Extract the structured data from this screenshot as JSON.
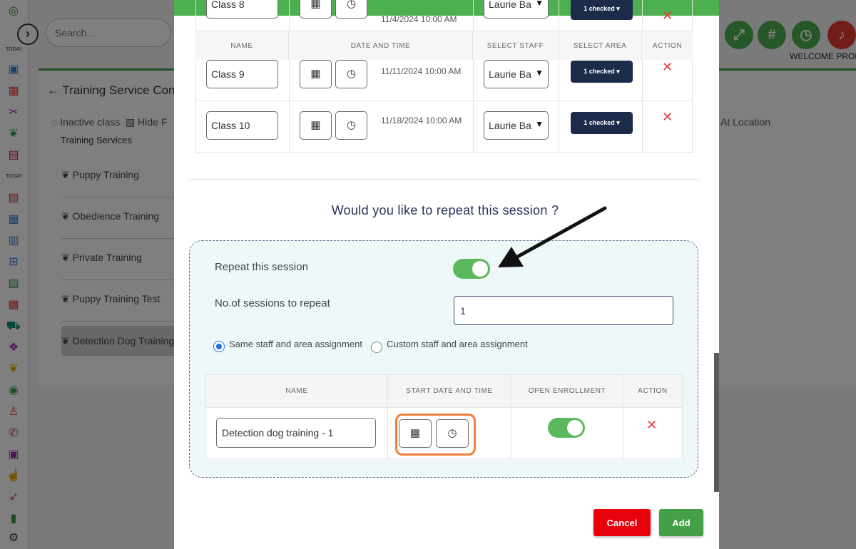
{
  "background": {
    "search_placeholder": "Search...",
    "welcome": "WELCOME PROD",
    "page_title": "Training Service Confi",
    "filter_inactive": "Inactive class",
    "filter_hide": "Hide F",
    "at_location": "At Location",
    "services_heading": "Training Services",
    "services": [
      "Puppy Training",
      "Obedience Training",
      "Private Training",
      "Puppy Training Test",
      "Detection Dog Training"
    ],
    "top_icons": [
      "expand-icon",
      "hash-icon",
      "clock-icon",
      "bell-icon"
    ],
    "rail_icons": [
      "dashboard-icon",
      "calendar-icon",
      "grooming-icon",
      "paw-icon",
      "kennel-icon",
      "today-icon",
      "badge-icon",
      "schedule-icon",
      "event-icon",
      "grid-icon",
      "report-icon",
      "card-icon",
      "cart-icon",
      "dog-icon",
      "paw2-icon",
      "target-icon",
      "user-icon",
      "chat-icon",
      "gallery-icon",
      "thumbsup-icon",
      "rocket-icon",
      "stats-icon",
      "settings-icon"
    ]
  },
  "classes_table": {
    "headers": [
      "NAME",
      "DATE AND TIME",
      "SELECT STAFF",
      "SELECT AREA",
      "ACTION"
    ],
    "rows": [
      {
        "name": "Class 8",
        "datetime": "11/4/2024 10:00 AM",
        "staff": "Laurie Ba",
        "area": "1 checked"
      },
      {
        "name": "Class 9",
        "datetime": "11/11/2024 10:00 AM",
        "staff": "Laurie Ba",
        "area": "1 checked"
      },
      {
        "name": "Class 10",
        "datetime": "11/18/2024 10:00 AM",
        "staff": "Laurie Ba",
        "area": "1 checked"
      }
    ],
    "delete_glyph": "✕"
  },
  "repeat": {
    "question": "Would you like to repeat this session ?",
    "toggle_label": "Repeat this session",
    "toggle_on": true,
    "sessions_label": "No.of sessions to repeat",
    "sessions_value": "1",
    "radio_same": "Same staff and area assignment",
    "radio_custom": "Custom staff and area assignment",
    "selected_radio": "same"
  },
  "sessions_table": {
    "headers": [
      "NAME",
      "START DATE AND TIME",
      "OPEN ENROLLMENT",
      "ACTION"
    ],
    "rows": [
      {
        "name": "Detection dog training - 1",
        "open_enrollment": true
      }
    ]
  },
  "actions": {
    "cancel": "Cancel",
    "add": "Add"
  },
  "colors": {
    "accent_green": "#4caf50",
    "navy": "#1c2b4a",
    "cancel_red": "#e8000b",
    "highlight_orange": "#f07f3c"
  }
}
